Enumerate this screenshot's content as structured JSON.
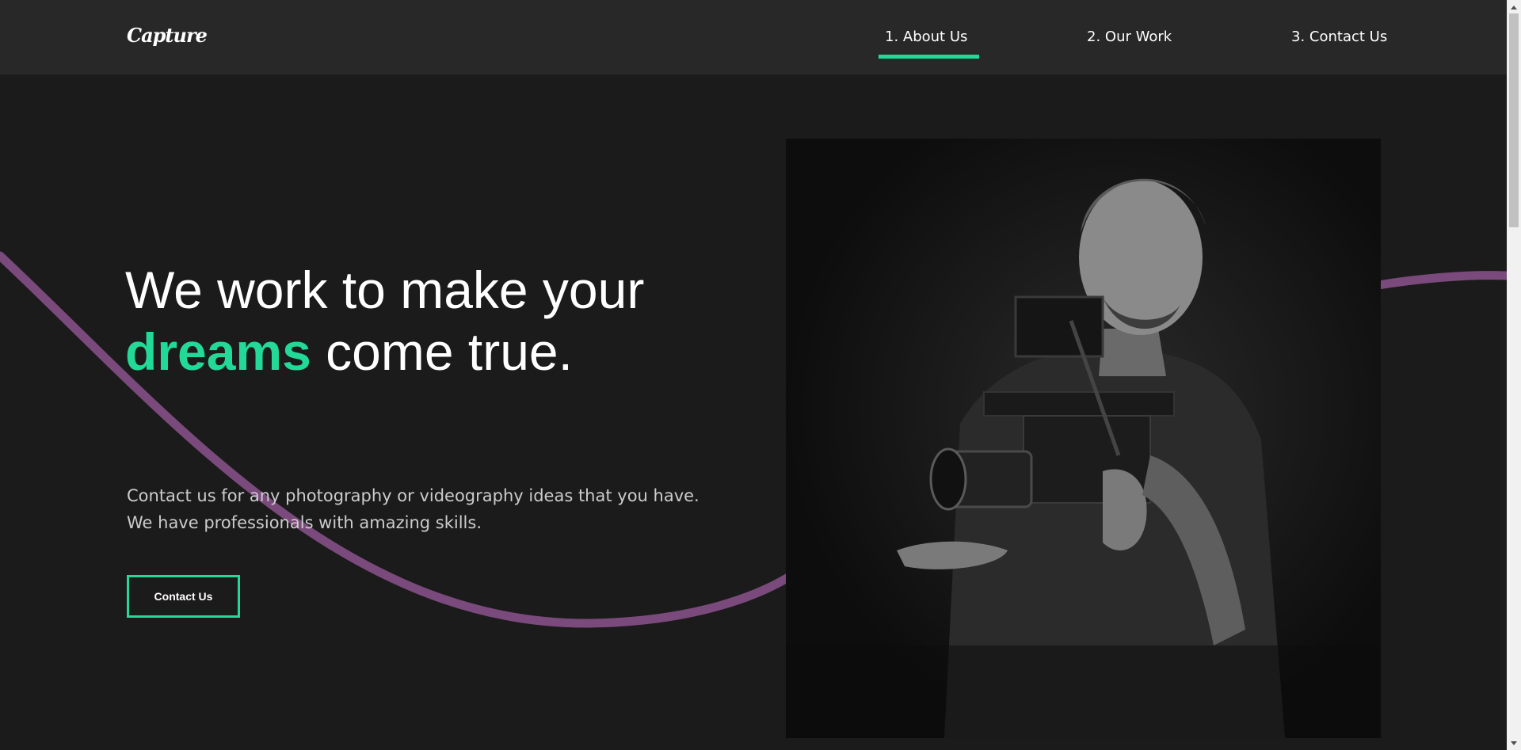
{
  "brand": {
    "logo": "Capture"
  },
  "nav": {
    "items": [
      {
        "label": "1. About Us",
        "active": true
      },
      {
        "label": "2. Our Work",
        "active": false
      },
      {
        "label": "3. Contact Us",
        "active": false
      }
    ]
  },
  "hero": {
    "title_before": "We work to make your ",
    "title_accent": "dreams",
    "title_after": " come true.",
    "text_line1": "Contact us for any photography or videography ideas that you have.",
    "text_line2": "We have professionals with amazing skills.",
    "button_label": "Contact Us"
  },
  "colors": {
    "accent": "#23d997",
    "wave": "#7b4a7c",
    "background": "#1b1b1b",
    "navbar": "#282828"
  },
  "icons": {
    "scroll_up": "chevron-up-icon",
    "scroll_down": "chevron-down-icon"
  }
}
